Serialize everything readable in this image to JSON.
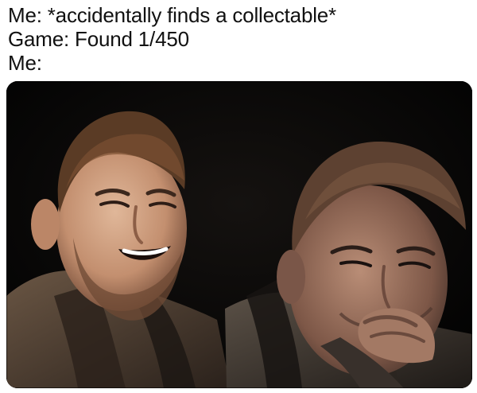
{
  "caption": {
    "lines": [
      "Me: *accidentally finds a collectable*",
      "Game: Found 1/450",
      "Me:"
    ]
  },
  "image": {
    "left_panel": {
      "expression": "laughing"
    },
    "right_panel": {
      "expression": "sad, hand over mouth"
    }
  },
  "colors": {
    "background": "#ffffff",
    "caption_text": "#111111",
    "photo_background": "#050505",
    "skin": "#c89a7a",
    "hair": "#5a3b25",
    "robe": "#4a3a2d"
  }
}
